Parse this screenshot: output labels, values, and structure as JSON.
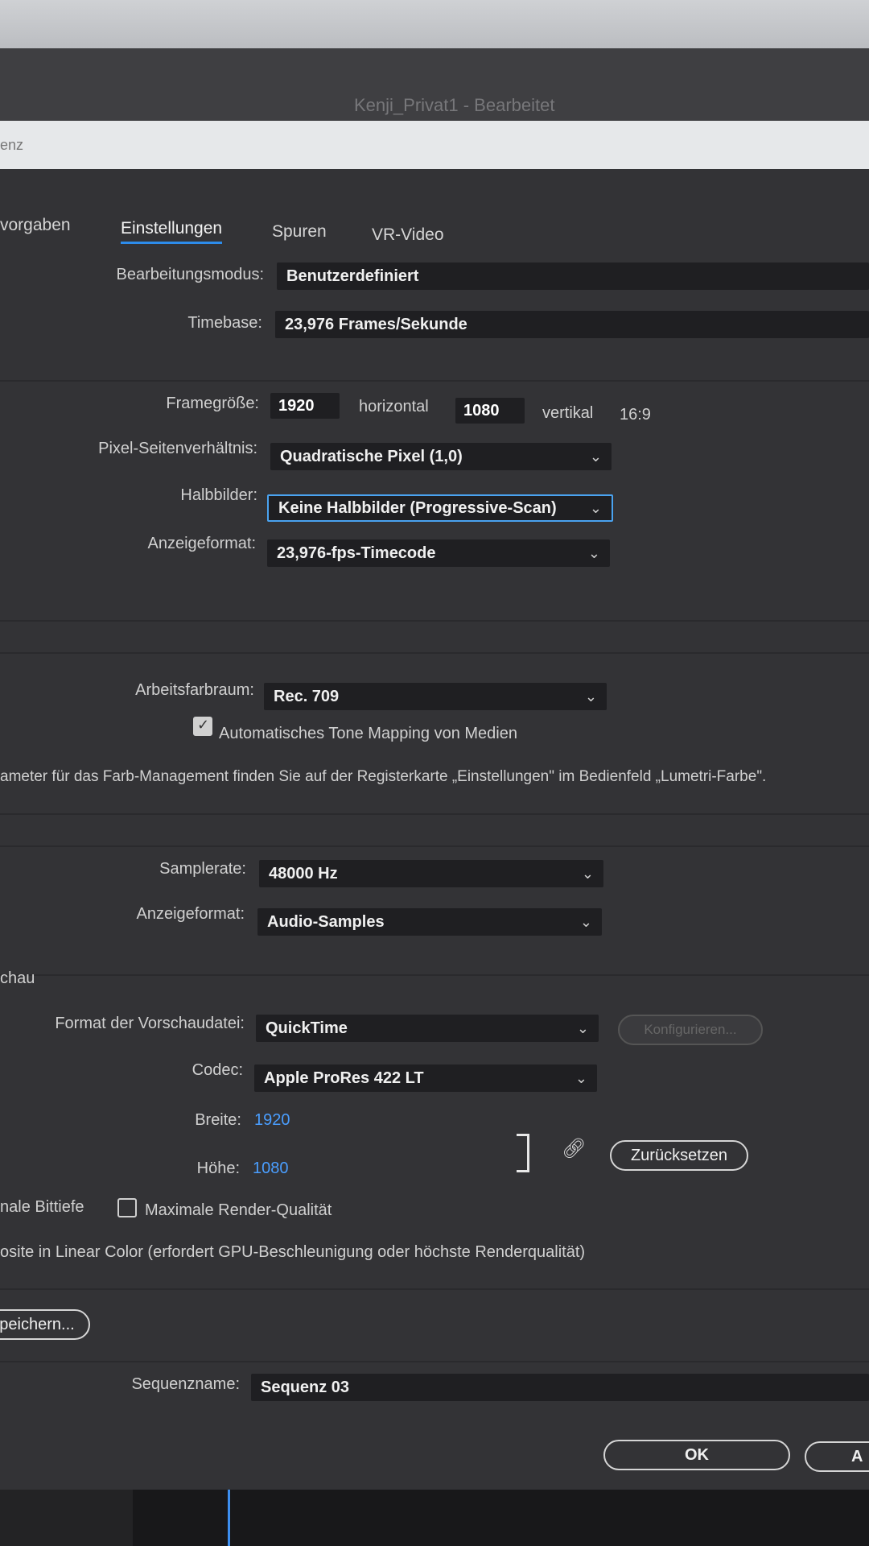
{
  "window": {
    "title": "Kenji_Privat1 - Bearbeitet"
  },
  "menubar": {
    "fragment": "enz"
  },
  "tabs": [
    {
      "label": "vorgaben"
    },
    {
      "label": "Einstellungen"
    },
    {
      "label": "Spuren"
    },
    {
      "label": "VR-Video"
    }
  ],
  "video": {
    "edit_mode_label": "Bearbeitungsmodus:",
    "edit_mode_value": "Benutzerdefiniert",
    "timebase_label": "Timebase:",
    "timebase_value": "23,976  Frames/Sekunde",
    "frame_size_label": "Framegröße:",
    "frame_width": "1920",
    "horizontal_label": "horizontal",
    "frame_height": "1080",
    "vertical_label": "vertikal",
    "aspect": "16:9",
    "pixel_aspect_label": "Pixel-Seitenverhältnis:",
    "pixel_aspect_value": "Quadratische Pixel (1,0)",
    "fields_label": "Halbbilder:",
    "fields_value": "Keine Halbbilder (Progressive-Scan)",
    "display_format_label": "Anzeigeformat:",
    "display_format_value": "23,976-fps-Timecode"
  },
  "color": {
    "working_space_label": "Arbeitsfarbraum:",
    "working_space_value": "Rec. 709",
    "tone_mapping_label": "Automatisches Tone Mapping von Medien",
    "info_text": "ameter für das Farb-Management finden Sie auf der Registerkarte „Einstellungen\" im Bedienfeld „Lumetri-Farbe\"."
  },
  "audio": {
    "sample_rate_label": "Samplerate:",
    "sample_rate_value": "48000 Hz",
    "display_format_label": "Anzeigeformat:",
    "display_format_value": "Audio-Samples"
  },
  "preview": {
    "section_label": "chau",
    "file_format_label": "Format der Vorschaudatei:",
    "file_format_value": "QuickTime",
    "configure_label": "Konfigurieren...",
    "codec_label": "Codec:",
    "codec_value": "Apple ProRes 422 LT",
    "width_label": "Breite:",
    "width_value": "1920",
    "height_label": "Höhe:",
    "height_value": "1080",
    "reset_label": "Zurücksetzen",
    "max_bit_depth_label": "nale Bittiefe",
    "max_render_quality_label": "Maximale Render-Qualität",
    "composite_linear_label": "osite in Linear Color (erfordert GPU-Beschleunigung oder höchste Renderqualität)"
  },
  "save_preset_label": "peichern...",
  "sequence_name_label": "Sequenzname:",
  "sequence_name_value": "Sequenz 03",
  "ok_label": "OK",
  "cancel_label": "A"
}
